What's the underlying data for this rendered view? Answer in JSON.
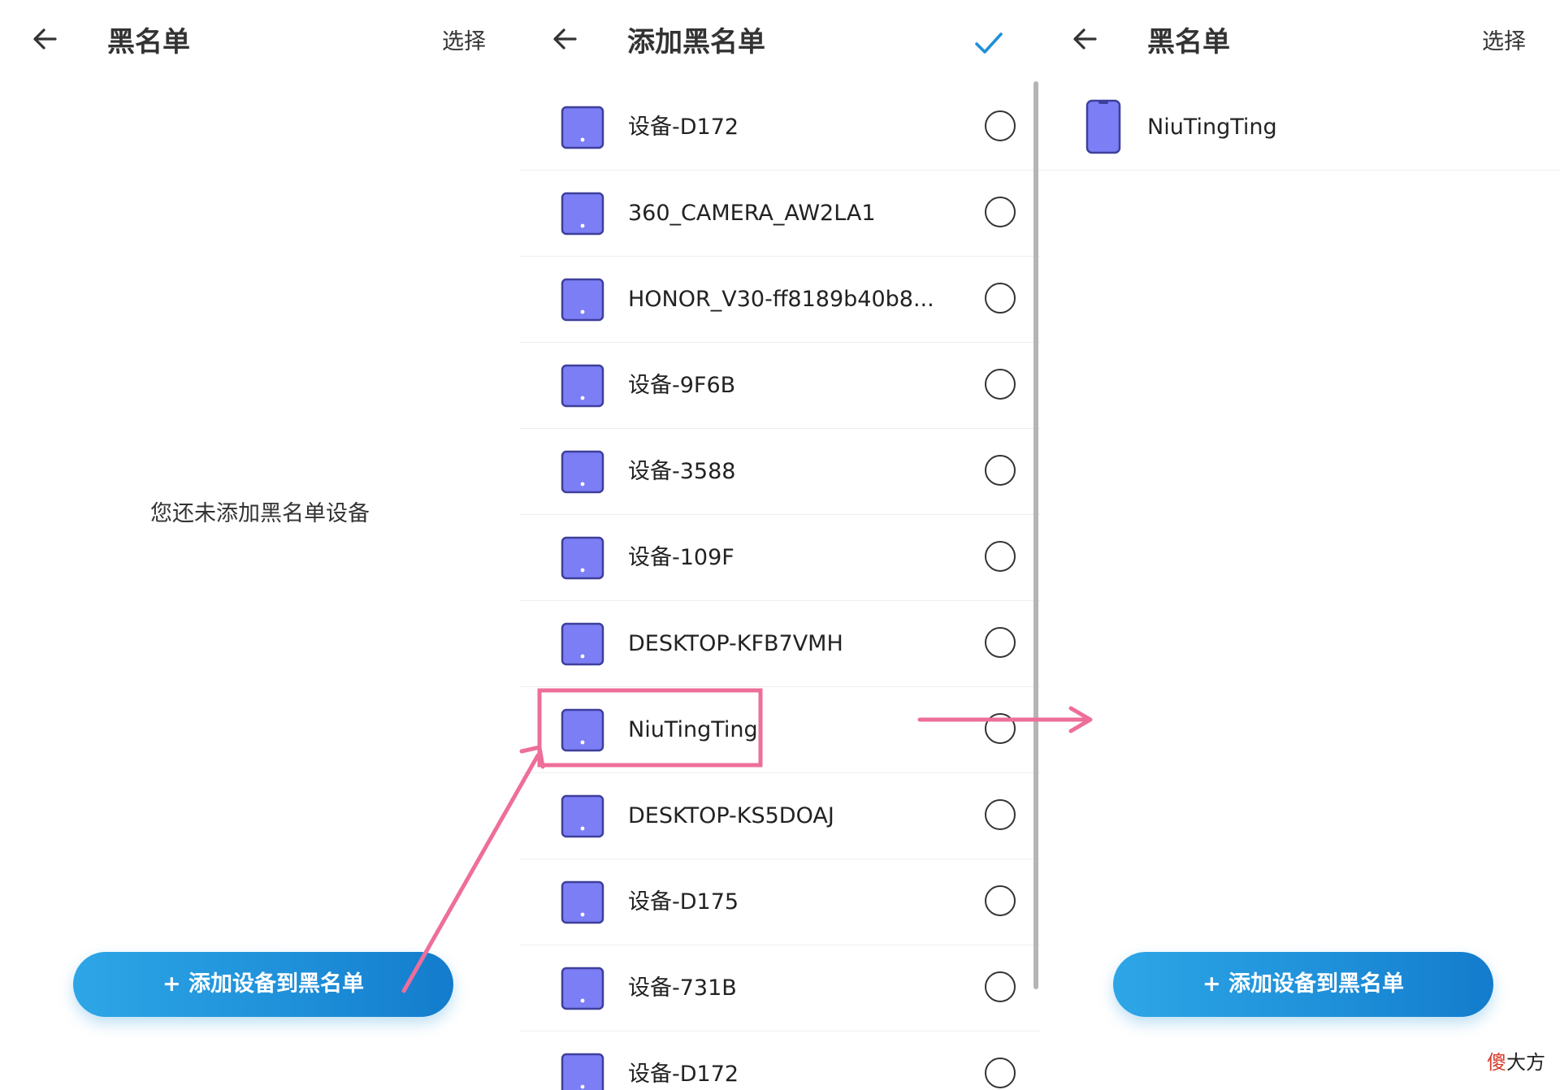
{
  "panel1": {
    "title": "黑名单",
    "action": "选择",
    "empty_text": "您还未添加黑名单设备",
    "add_button": "+ 添加设备到黑名单"
  },
  "panel2": {
    "title": "添加黑名单",
    "devices": [
      {
        "name": "设备-D172"
      },
      {
        "name": "360_CAMERA_AW2LA1"
      },
      {
        "name": "HONOR_V30-ff8189b40b8..."
      },
      {
        "name": "设备-9F6B"
      },
      {
        "name": "设备-3588"
      },
      {
        "name": "设备-109F"
      },
      {
        "name": "DESKTOP-KFB7VMH"
      },
      {
        "name": "NiuTingTing"
      },
      {
        "name": "DESKTOP-KS5DOAJ"
      },
      {
        "name": "设备-D175"
      },
      {
        "name": "设备-731B"
      },
      {
        "name": "设备-D172"
      }
    ]
  },
  "panel3": {
    "title": "黑名单",
    "action": "选择",
    "devices": [
      {
        "name": "NiuTingTing"
      }
    ],
    "add_button": "+ 添加设备到黑名单"
  },
  "watermark": {
    "red": "傻",
    "dark": "大方"
  },
  "colors": {
    "accent_blue": "#1e8fd9",
    "device_icon": "#7c7ef5",
    "annotation_pink": "#ee6e9a"
  }
}
